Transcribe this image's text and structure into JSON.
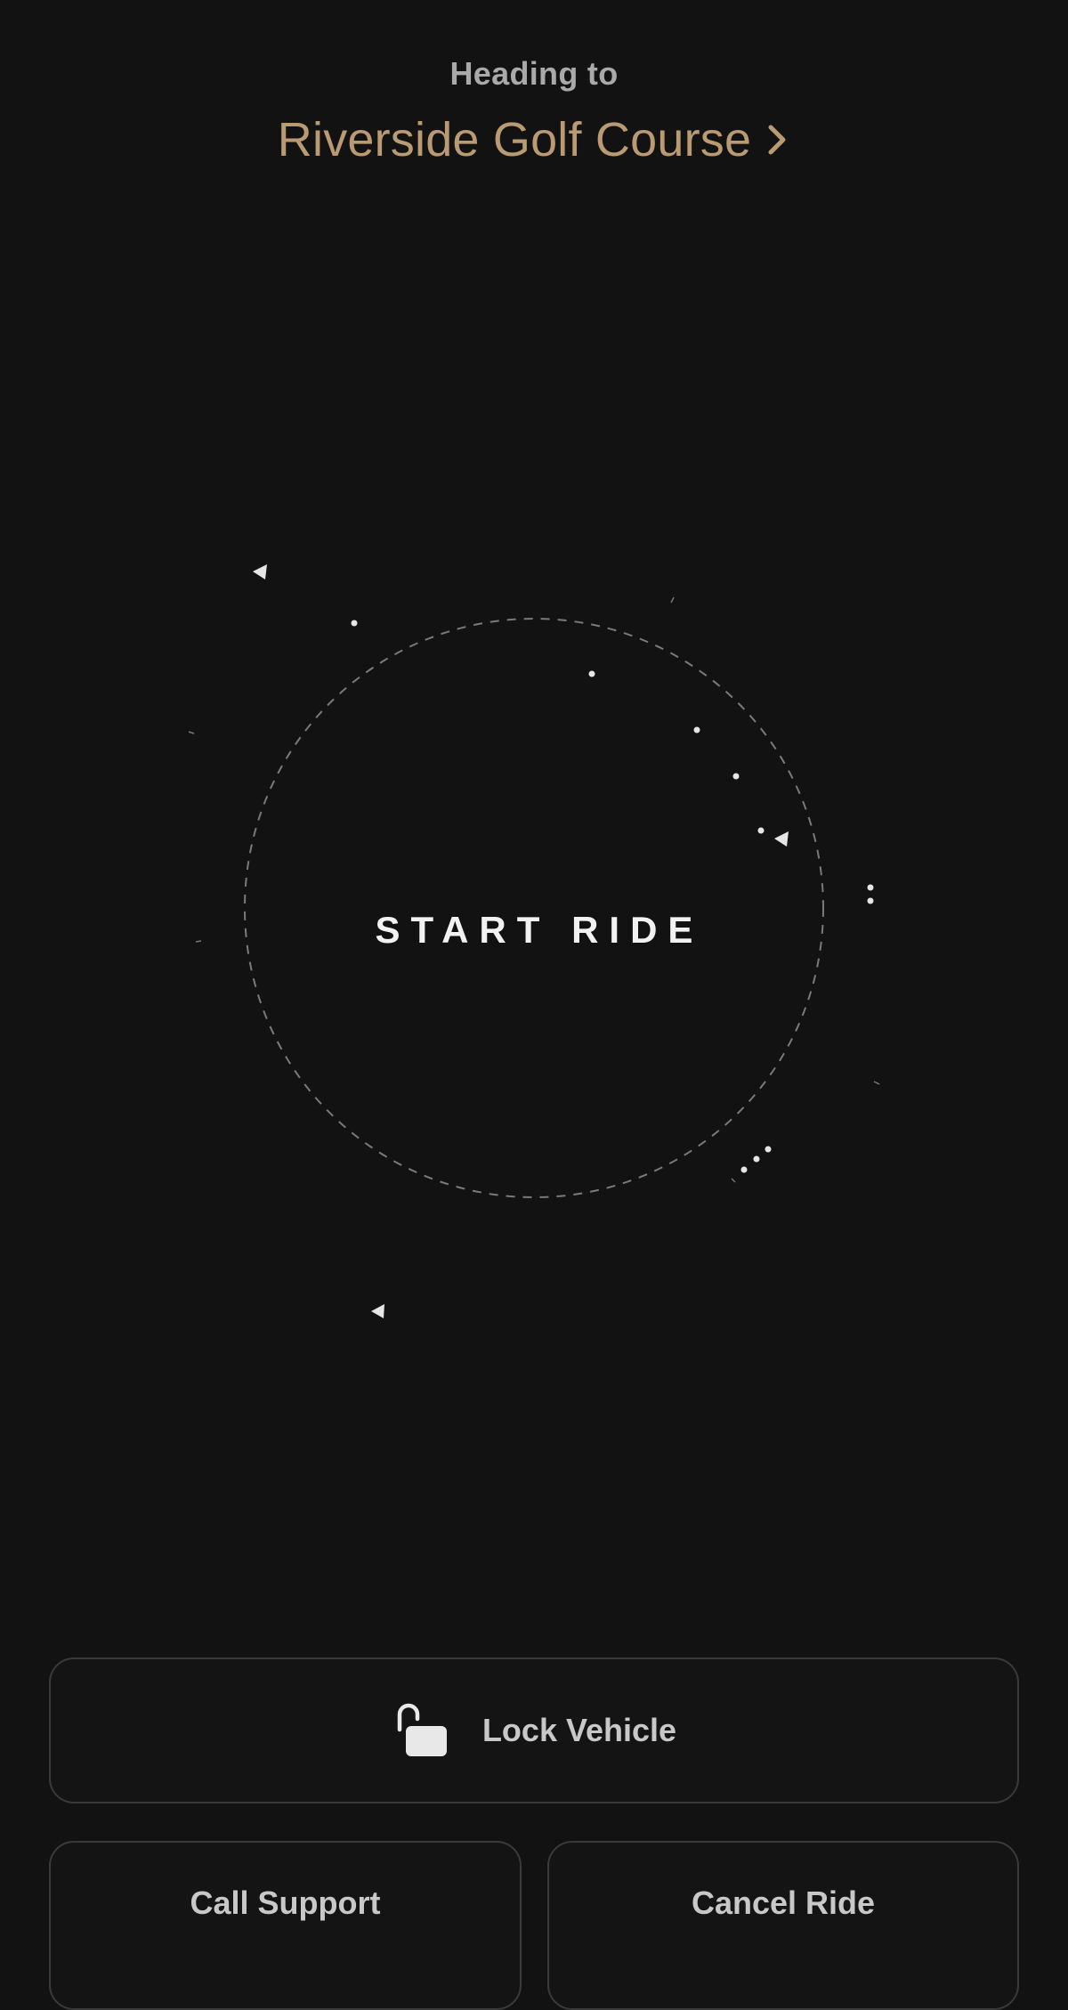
{
  "header": {
    "heading_label": "Heading to",
    "destination": "Riverside Golf Course",
    "destination_color": "#b99a72"
  },
  "ride": {
    "start_label": "START RIDE"
  },
  "actions": {
    "lock_label": "Lock Vehicle",
    "call_support_label": "Call Support",
    "cancel_ride_label": "Cancel Ride"
  },
  "icons": {
    "destination_chevron": "chevron-right-icon",
    "lock": "unlocked-padlock-icon"
  },
  "colors": {
    "background": "#121212",
    "ring": "#7a7a7a",
    "button_border": "#3a3a3a"
  }
}
